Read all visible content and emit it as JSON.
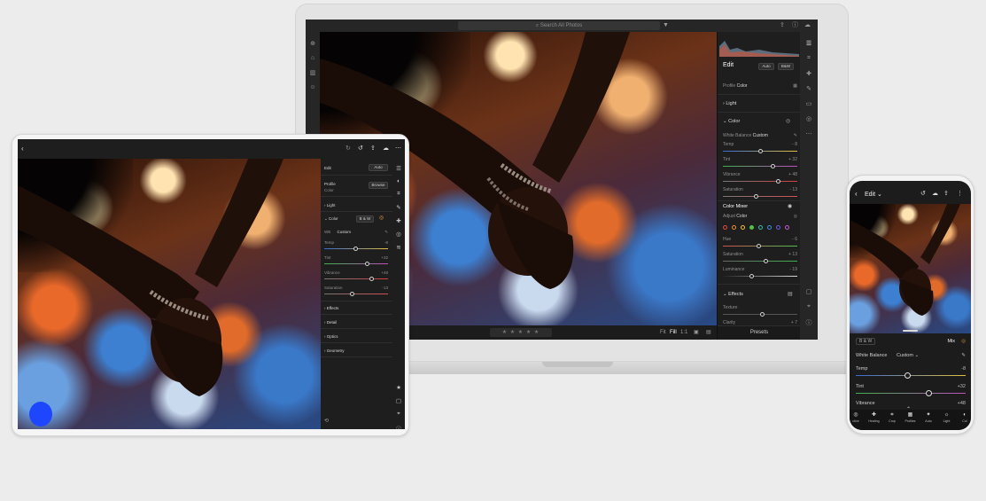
{
  "laptop": {
    "search_placeholder": "Search All Photos",
    "panel": {
      "edit_title": "Edit",
      "auto_label": "Auto",
      "bw_label": "B&W",
      "profile_label": "Profile",
      "profile_value": "Color",
      "light_label": "Light",
      "color_label": "Color",
      "white_balance_label": "White Balance",
      "white_balance_value": "Custom",
      "temp_label": "Temp",
      "temp_value": "- 8",
      "tint_label": "Tint",
      "tint_value": "+ 32",
      "vibrance_label": "Vibrance",
      "vibrance_value": "+ 48",
      "saturation_label": "Saturation",
      "saturation_value": "- 13",
      "color_mixer_label": "Color Mixer",
      "adjust_label": "Adjust",
      "adjust_value": "Color",
      "hue_label": "Hue",
      "hue_value": "- 6",
      "mixer_saturation_label": "Saturation",
      "mixer_saturation_value": "+ 13",
      "luminance_label": "Luminance",
      "luminance_value": "- 19",
      "effects_label": "Effects",
      "texture_label": "Texture",
      "clarity_label": "Clarity",
      "clarity_value": "+ 7",
      "presets_label": "Presets",
      "mixer_colors": [
        "#e84b3c",
        "#f08a2c",
        "#f2c230",
        "#4fc24a",
        "#3ab8a8",
        "#3a8de0",
        "#6a5ae0",
        "#c85ad0"
      ]
    },
    "bottom_bar": {
      "rating": "★ ★ ★ ★ ★",
      "fit_label": "Fit",
      "fill_label": "Fill",
      "one_to_one_label": "1:1"
    }
  },
  "tablet": {
    "panel": {
      "edit_label": "Edit",
      "auto_label": "Auto",
      "profile_label": "Profile",
      "profile_value": "Color",
      "browse_label": "Browse",
      "light_label": "Light",
      "color_label": "Color",
      "bw_label": "B & W",
      "wb_label": "WB",
      "wb_value": "Custom",
      "temp_label": "Temp",
      "temp_value": "-8",
      "tint_label": "Tint",
      "tint_value": "+32",
      "vibrance_label": "Vibrance",
      "vibrance_value": "+48",
      "saturation_label": "Saturation",
      "saturation_value": "-13",
      "effects_label": "Effects",
      "detail_label": "Detail",
      "optics_label": "Optics",
      "geometry_label": "Geometry"
    }
  },
  "phone": {
    "edit_label": "Edit",
    "bw_label": "B & W",
    "mix_label": "Mix",
    "white_balance_label": "White Balance",
    "white_balance_value": "Custom",
    "temp_label": "Temp",
    "temp_value": "-8",
    "tint_label": "Tint",
    "tint_value": "+32",
    "vibrance_label": "Vibrance",
    "vibrance_value": "+48",
    "tools": [
      {
        "label": "ctive",
        "icon": "selective-icon"
      },
      {
        "label": "Healing",
        "icon": "healing-icon"
      },
      {
        "label": "Crop",
        "icon": "crop-icon"
      },
      {
        "label": "Profiles",
        "icon": "profiles-icon"
      },
      {
        "label": "Auto",
        "icon": "auto-icon"
      },
      {
        "label": "Light",
        "icon": "light-icon"
      },
      {
        "label": "Col",
        "icon": "color-icon"
      }
    ]
  }
}
